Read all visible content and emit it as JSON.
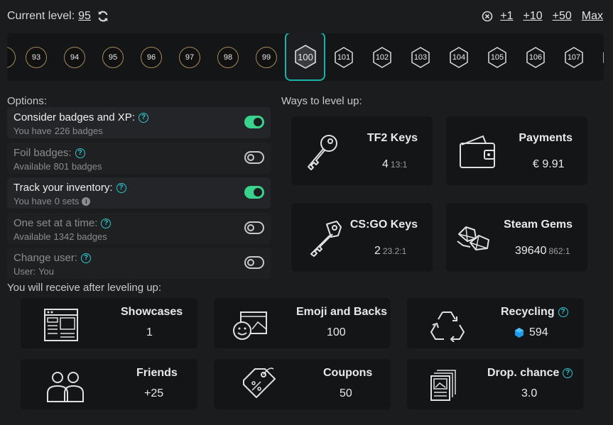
{
  "header": {
    "current_level_label": "Current level:",
    "current_level": "95",
    "quick_add": [
      "+1",
      "+10",
      "+50",
      "Max"
    ]
  },
  "levels": {
    "before": [
      "93",
      "94",
      "95",
      "96",
      "97",
      "98",
      "99"
    ],
    "current": "100",
    "after": [
      "101",
      "102",
      "103",
      "104",
      "105",
      "106",
      "107"
    ]
  },
  "options": {
    "label": "Options:",
    "items": [
      {
        "title": "Consider badges and XP:",
        "sub_prefix": "You have",
        "sub_value": "226 badges",
        "enabled": true
      },
      {
        "title": "Foil badges:",
        "sub_prefix": "Available",
        "sub_value": "801 badges",
        "enabled": false
      },
      {
        "title": "Track your inventory:",
        "sub_prefix": "You have",
        "sub_value": "0 sets",
        "enabled": true
      },
      {
        "title": "One set at a time:",
        "sub_prefix": "Available",
        "sub_value": "1342 badges",
        "enabled": false
      },
      {
        "title": "Change user:",
        "sub_prefix": "User:",
        "sub_value": "You",
        "enabled": false
      }
    ]
  },
  "ways": {
    "label": "Ways to level up:",
    "items": [
      {
        "name": "TF2 Keys",
        "value": "4",
        "ratio": "13:1",
        "icon": "key-icon"
      },
      {
        "name": "Payments",
        "value": "€ 9.91",
        "ratio": "",
        "icon": "wallet-icon"
      },
      {
        "name": "CS:GO Keys",
        "value": "2",
        "ratio": "23.2:1",
        "icon": "csgo-key-icon"
      },
      {
        "name": "Steam Gems",
        "value": "39640",
        "ratio": "862:1",
        "icon": "gems-icon"
      }
    ]
  },
  "receive": {
    "label": "You will receive after leveling up:",
    "items": [
      {
        "name": "Showcases",
        "value": "1"
      },
      {
        "name": "Emoji and Backs",
        "value": "100"
      },
      {
        "name": "Recycling",
        "value": "594"
      },
      {
        "name": "Friends",
        "value": "+25"
      },
      {
        "name": "Coupons",
        "value": "50"
      },
      {
        "name": "Drop. chance",
        "value": "3.0"
      }
    ]
  },
  "colors": {
    "accent": "#17b3a9",
    "toggle_on": "#3ad38e",
    "help": "#30c5ce"
  }
}
